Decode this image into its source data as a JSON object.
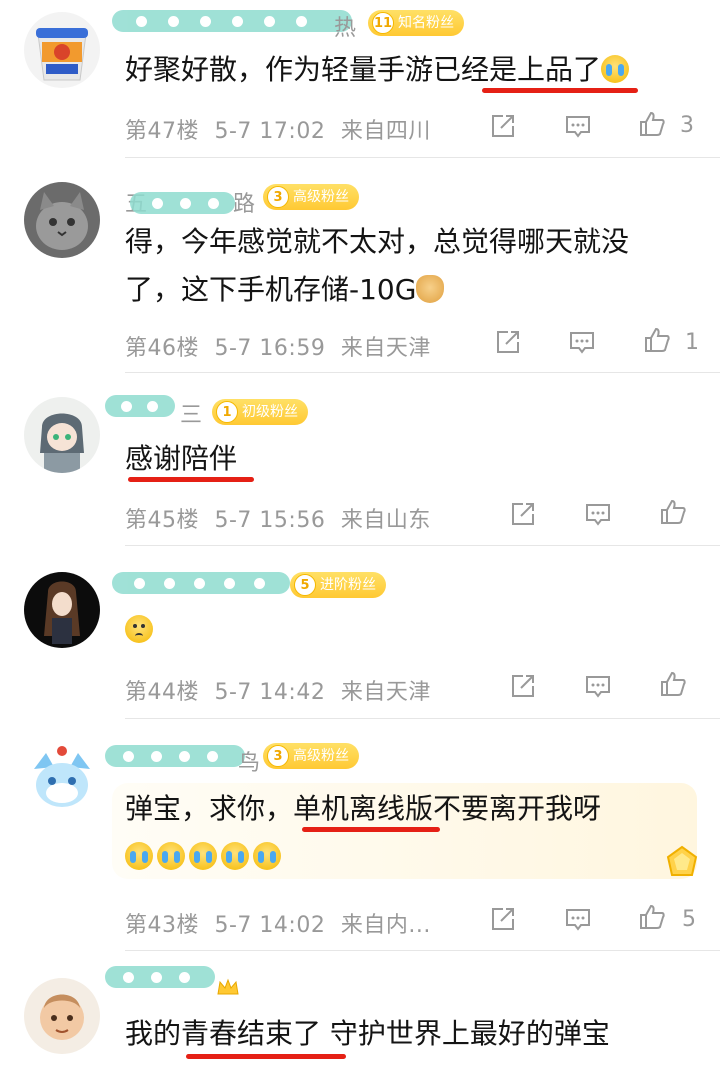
{
  "comments": [
    {
      "name_tail": "热",
      "badge_level": "11",
      "badge_label": "知名粉丝",
      "text": "好聚好散，作为轻量手游已经是上品了",
      "floor": "第47楼",
      "date": "5-7 17:02",
      "location": "来自四川",
      "likes": "3"
    },
    {
      "name_head": "五",
      "name_tail": "路",
      "badge_level": "3",
      "badge_label": "高级粉丝",
      "text_line1": "得，今年感觉就不太对，总觉得哪天就没",
      "text_line2": "了，这下手机存储-10G",
      "floor": "第46楼",
      "date": "5-7 16:59",
      "location": "来自天津",
      "likes": "1"
    },
    {
      "name_tail": "三",
      "badge_level": "1",
      "badge_label": "初级粉丝",
      "text": "感谢陪伴",
      "floor": "第45楼",
      "date": "5-7 15:56",
      "location": "来自山东",
      "likes": ""
    },
    {
      "badge_level": "5",
      "badge_label": "进阶粉丝",
      "floor": "第44楼",
      "date": "5-7 14:42",
      "location": "来自天津",
      "likes": ""
    },
    {
      "name_tail": "鸟",
      "badge_level": "3",
      "badge_label": "高级粉丝",
      "text": "弹宝，求你，单机离线版不要离开我呀",
      "floor": "第43楼",
      "date": "5-7 14:02",
      "location": "来自内...",
      "likes": "5"
    },
    {
      "text": "我的青春结束了 守护世界上最好的弹宝"
    }
  ],
  "colors": {
    "underline": "#e52015",
    "name_blur": "#8fdcd0",
    "badge": "#ffc933",
    "meta": "#999999"
  },
  "icons": [
    "share-icon",
    "reply-icon",
    "like-icon",
    "crying-emoji",
    "doge-emoji",
    "worried-emoji",
    "crown-icon",
    "gem-icon"
  ]
}
